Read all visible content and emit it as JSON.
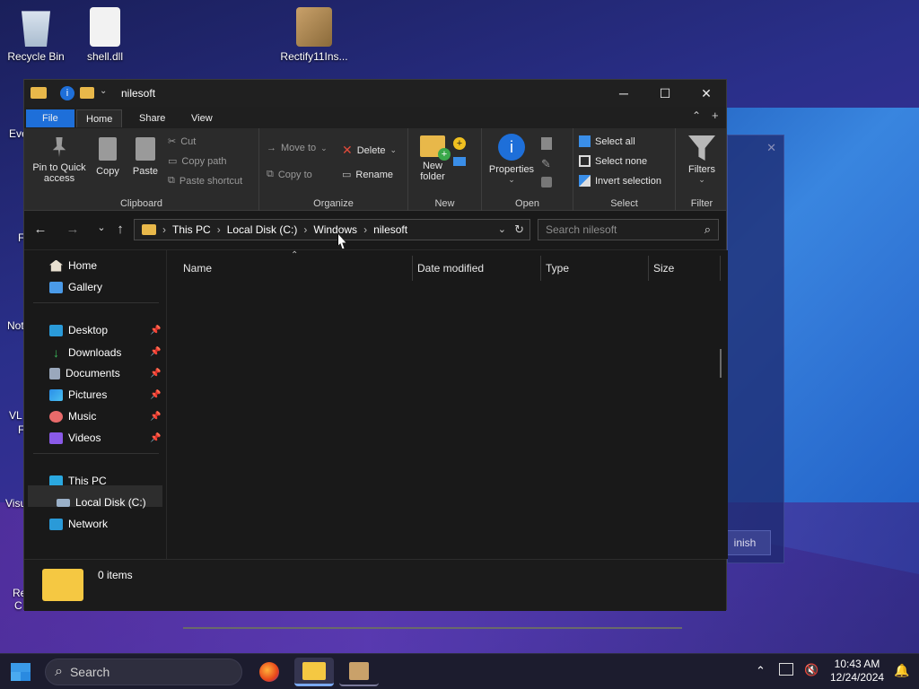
{
  "desktop": {
    "icons": [
      {
        "label": "Recycle Bin",
        "icon": "recycle-bin-icon"
      },
      {
        "label": "shell.dll",
        "icon": "dll-file-icon"
      },
      {
        "label": "Rectify11Ins...",
        "icon": "installer-icon"
      }
    ],
    "partial_labels": [
      "Eve",
      "F",
      "Not",
      "VL",
      "F",
      "Visu",
      "Re",
      "C"
    ],
    "background_dialog_button": "inish"
  },
  "window": {
    "title": "nilesoft",
    "minimize": "─",
    "maximize": "☐",
    "close": "✕"
  },
  "ribbon": {
    "tabs": [
      "File",
      "Home",
      "Share",
      "View"
    ],
    "clipboard": {
      "pin_label": "Pin to Quick access",
      "copy_label": "Copy",
      "paste_label": "Paste",
      "cut_label": "Cut",
      "copy_path_label": "Copy path",
      "paste_shortcut_label": "Paste shortcut",
      "group_label": "Clipboard"
    },
    "organize": {
      "move_to_label": "Move to",
      "copy_to_label": "Copy to",
      "delete_label": "Delete",
      "rename_label": "Rename",
      "group_label": "Organize"
    },
    "new": {
      "new_folder_label": "New folder",
      "group_label": "New"
    },
    "open": {
      "properties_label": "Properties",
      "group_label": "Open"
    },
    "select": {
      "select_all_label": "Select all",
      "select_none_label": "Select none",
      "invert_selection_label": "Invert selection",
      "group_label": "Select"
    },
    "filter": {
      "filters_label": "Filters",
      "group_label": "Filter"
    }
  },
  "address": {
    "crumbs": [
      "This PC",
      "Local Disk (C:)",
      "Windows",
      "nilesoft"
    ],
    "search_placeholder": "Search nilesoft"
  },
  "nav": {
    "home": "Home",
    "gallery": "Gallery",
    "quick": [
      "Desktop",
      "Downloads",
      "Documents",
      "Pictures",
      "Music",
      "Videos"
    ],
    "this_pc": "This PC",
    "local_disk": "Local Disk (C:)",
    "network": "Network"
  },
  "columns": [
    "Name",
    "Date modified",
    "Type",
    "Size"
  ],
  "status": {
    "items": "0 items"
  },
  "taskbar": {
    "search_label": "Search",
    "time": "10:43 AM",
    "date": "12/24/2024"
  },
  "colors": {
    "accent": "#1e6fd9",
    "window_bg": "#191919",
    "ribbon_bg": "#2b2b2b"
  }
}
